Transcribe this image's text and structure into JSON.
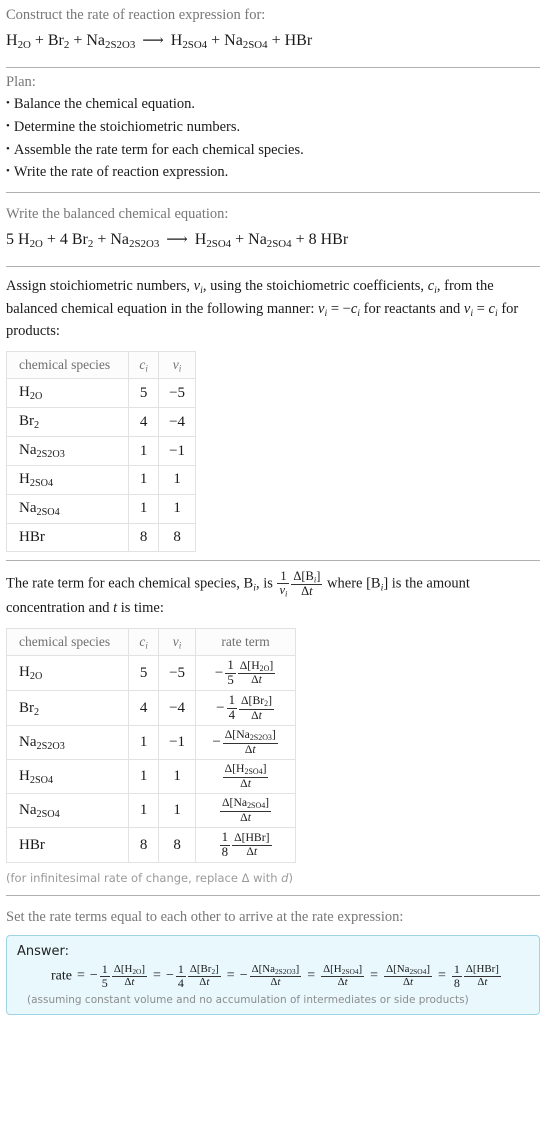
{
  "header": {
    "prompt": "Construct the rate of reaction expression for:",
    "equation": {
      "reactants": [
        "H_2O",
        "Br_2",
        "Na_2S_2O_3"
      ],
      "products": [
        "H_2SO_4",
        "Na_2SO_4",
        "HBr"
      ],
      "arrow": "⟶"
    }
  },
  "plan": {
    "title": "Plan:",
    "bullet": "•",
    "items": [
      "Balance the chemical equation.",
      "Determine the stoichiometric numbers.",
      "Assemble the rate term for each chemical species.",
      "Write the rate of reaction expression."
    ]
  },
  "balanced": {
    "title": "Write the balanced chemical equation:",
    "reactants": [
      {
        "coef": "5",
        "formula": "H_2O"
      },
      {
        "coef": "4",
        "formula": "Br_2"
      },
      {
        "coef": "",
        "formula": "Na_2S_2O_3"
      }
    ],
    "products": [
      {
        "coef": "",
        "formula": "H_2SO_4"
      },
      {
        "coef": "",
        "formula": "Na_2SO_4"
      },
      {
        "coef": "8",
        "formula": "HBr"
      }
    ],
    "arrow": "⟶"
  },
  "stoich": {
    "intro_1": "Assign stoichiometric numbers, ",
    "intro_2": ", using the stoichiometric coefficients, ",
    "intro_3": ", from the balanced chemical equation in the following manner: ",
    "intro_4": " = −",
    "intro_5": " for reactants and ",
    "intro_6": " = ",
    "intro_7": " for products:",
    "sym_nu": "ν",
    "sym_c": "c",
    "sym_i": "i",
    "headers": [
      "chemical species",
      "c_i",
      "ν_i"
    ],
    "rows": [
      {
        "species": "H_2O",
        "c": "5",
        "nu": "−5"
      },
      {
        "species": "Br_2",
        "c": "4",
        "nu": "−4"
      },
      {
        "species": "Na_2S_2O_3",
        "c": "1",
        "nu": "−1"
      },
      {
        "species": "H_2SO_4",
        "c": "1",
        "nu": "1"
      },
      {
        "species": "Na_2SO_4",
        "c": "1",
        "nu": "1"
      },
      {
        "species": "HBr",
        "c": "8",
        "nu": "8"
      }
    ]
  },
  "rate_terms": {
    "intro_1": "The rate term for each chemical species, B",
    "intro_2": ", is ",
    "intro_3": " where [B",
    "intro_4": "] is the amount concentration and ",
    "intro_5": " is time:",
    "sym_t": "t",
    "generic_fraction": {
      "num_top": "1",
      "num_bot": "ν_i",
      "top": "Δ[B_i]",
      "bot": "Δt"
    },
    "headers": [
      "chemical species",
      "c_i",
      "ν_i",
      "rate term"
    ],
    "rows": [
      {
        "species": "H_2O",
        "c": "5",
        "nu": "−5",
        "sign": "−",
        "coef_top": "1",
        "coef_bot": "5",
        "delta_num": "Δ[H_2O]",
        "delta_den": "Δt"
      },
      {
        "species": "Br_2",
        "c": "4",
        "nu": "−4",
        "sign": "−",
        "coef_top": "1",
        "coef_bot": "4",
        "delta_num": "Δ[Br_2]",
        "delta_den": "Δt"
      },
      {
        "species": "Na_2S_2O_3",
        "c": "1",
        "nu": "−1",
        "sign": "−",
        "coef_top": "",
        "coef_bot": "",
        "delta_num": "Δ[Na_2S_2O_3]",
        "delta_den": "Δt"
      },
      {
        "species": "H_2SO_4",
        "c": "1",
        "nu": "1",
        "sign": "",
        "coef_top": "",
        "coef_bot": "",
        "delta_num": "Δ[H_2SO_4]",
        "delta_den": "Δt"
      },
      {
        "species": "Na_2SO_4",
        "c": "1",
        "nu": "1",
        "sign": "",
        "coef_top": "",
        "coef_bot": "",
        "delta_num": "Δ[Na_2SO_4]",
        "delta_den": "Δt"
      },
      {
        "species": "HBr",
        "c": "8",
        "nu": "8",
        "sign": "",
        "coef_top": "1",
        "coef_bot": "8",
        "delta_num": "Δ[HBr]",
        "delta_den": "Δt"
      }
    ],
    "footnote": "(for infinitesimal rate of change, replace Δ with d)"
  },
  "final": {
    "intro": "Set the rate terms equal to each other to arrive at the rate expression:",
    "answer_label": "Answer:",
    "rate_word": "rate",
    "equals": "=",
    "terms": [
      {
        "sign": "−",
        "coef_top": "1",
        "coef_bot": "5",
        "num": "Δ[H_2O]",
        "den": "Δt"
      },
      {
        "sign": "−",
        "coef_top": "1",
        "coef_bot": "4",
        "num": "Δ[Br_2]",
        "den": "Δt"
      },
      {
        "sign": "−",
        "coef_top": "",
        "coef_bot": "",
        "num": "Δ[Na_2S_2O_3]",
        "den": "Δt"
      },
      {
        "sign": "",
        "coef_top": "",
        "coef_bot": "",
        "num": "Δ[H_2SO_4]",
        "den": "Δt"
      },
      {
        "sign": "",
        "coef_top": "",
        "coef_bot": "",
        "num": "Δ[Na_2SO_4]",
        "den": "Δt"
      },
      {
        "sign": "",
        "coef_top": "1",
        "coef_bot": "8",
        "num": "Δ[HBr]",
        "den": "Δt"
      }
    ],
    "assumption": "(assuming constant volume and no accumulation of intermediates or side products)"
  },
  "colors": {
    "answer_bg": "#e8f8fd",
    "answer_border": "#9fd4e4",
    "muted_text": "#777777",
    "table_border": "#e2e2e2",
    "separator": "#b0b0b0"
  }
}
